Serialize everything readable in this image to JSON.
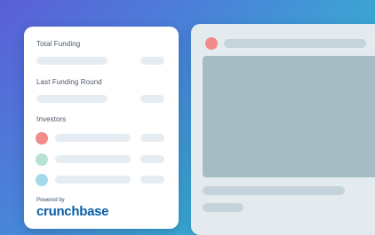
{
  "card": {
    "total_funding_label": "Total Funding",
    "last_round_label": "Last Funding Round",
    "investors_label": "Investors",
    "powered_by": "Powered by",
    "brand": "crunchbase"
  },
  "colors": {
    "investor_1": "#f28b8b",
    "investor_2": "#b6e3d6",
    "investor_3": "#a6d8ec",
    "preview_dot": "#f28b8b",
    "brand": "#0a5ea8"
  }
}
